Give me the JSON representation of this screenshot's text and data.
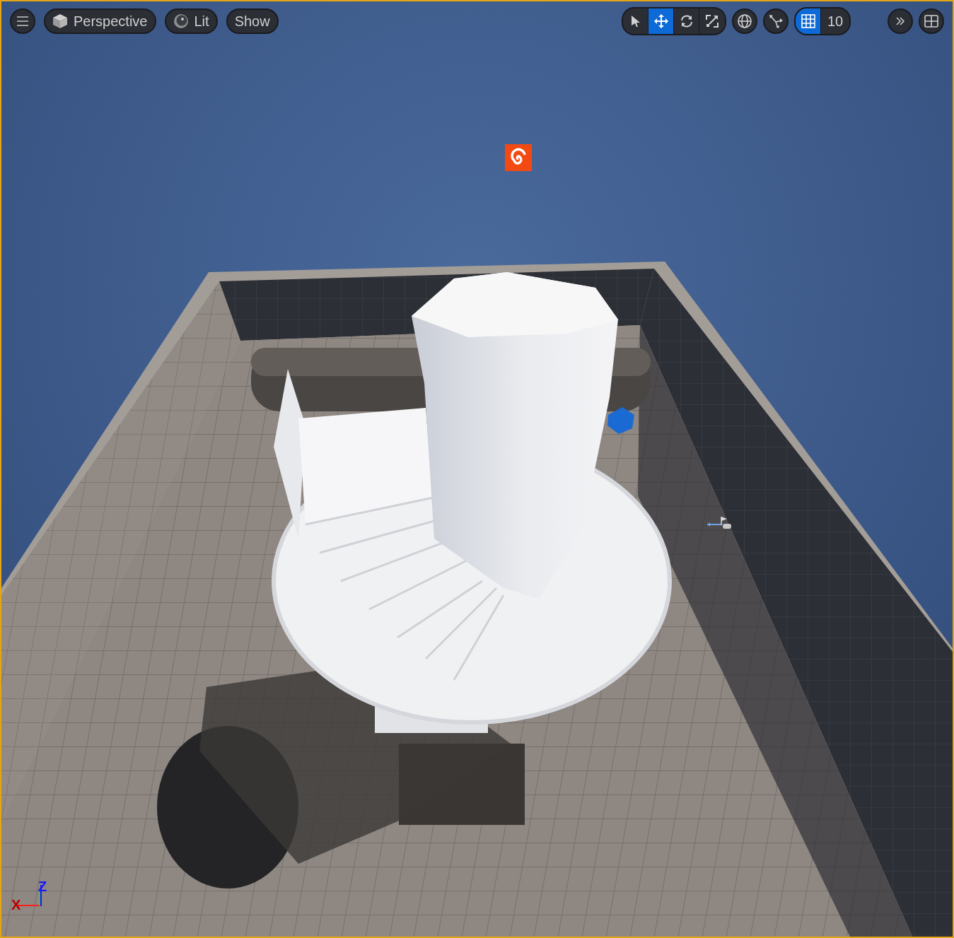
{
  "toolbar": {
    "view_mode": "Perspective",
    "lighting": "Lit",
    "show": "Show"
  },
  "transform_tools": [
    {
      "kind": "select",
      "selected": false
    },
    {
      "kind": "translate",
      "selected": true
    },
    {
      "kind": "rotate",
      "selected": false
    },
    {
      "kind": "scale",
      "selected": false
    }
  ],
  "grid_snap": {
    "on": true,
    "value": "10"
  },
  "axis_gizmo": {
    "x_label": "X",
    "z_label": "Z"
  }
}
